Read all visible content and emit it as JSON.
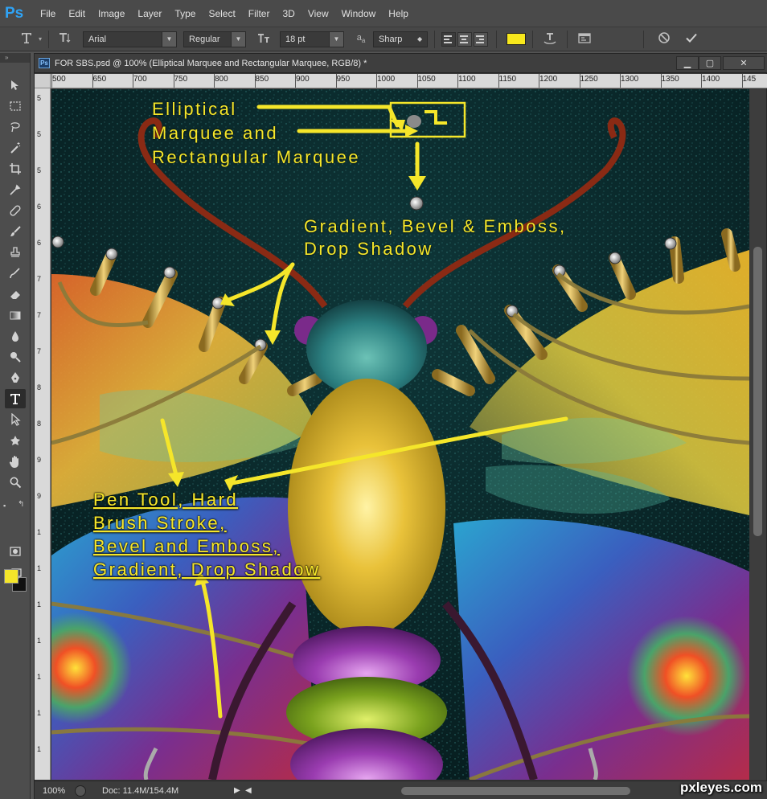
{
  "app_logo": "Ps",
  "menu": [
    "File",
    "Edit",
    "Image",
    "Layer",
    "Type",
    "Select",
    "Filter",
    "3D",
    "View",
    "Window",
    "Help"
  ],
  "options": {
    "font_family": "Arial",
    "font_style": "Regular",
    "font_size": "18 pt",
    "aa_label": "a",
    "aa_sub": "a",
    "antialias": "Sharp",
    "text_color": "#f8e81c"
  },
  "document": {
    "title": "FOR SBS.psd @ 100% (Elliptical Marquee and Rectangular Marquee, RGB/8) *",
    "ps_icon": "Ps",
    "ruler_top": [
      "500",
      "650",
      "700",
      "750",
      "800",
      "850",
      "900",
      "950",
      "1000",
      "1050",
      "1100",
      "1150",
      "1200",
      "1250",
      "1300",
      "1350",
      "1400",
      "145"
    ],
    "ruler_left": [
      "5",
      "5",
      "5",
      "6",
      "6",
      "7",
      "7",
      "7",
      "8",
      "8",
      "9",
      "9",
      "1",
      "1",
      "1",
      "1",
      "1",
      "1",
      "1"
    ]
  },
  "annotations": {
    "marquee": [
      "Elliptical",
      "Marquee and",
      "Rectangular Marquee"
    ],
    "gradient": [
      "Gradient, Bevel & Emboss,",
      "Drop Shadow"
    ],
    "pen": [
      "Pen Tool, Hard",
      "Brush Stroke,",
      "Bevel and Emboss,",
      "Gradient, Drop Shadow"
    ]
  },
  "colors": {
    "annotation": "#f5e62a",
    "fg_swatch": "#f5e62a",
    "bg_swatch": "#111111",
    "accent_blue": "#2fa3f5"
  },
  "status": {
    "zoom": "100%",
    "doc": "Doc: 11.4M/154.4M"
  },
  "watermark": "pxleyes.com",
  "icons": [
    "text-tool-icon",
    "text-orientation-icon",
    "font-size-icon",
    "align-left-icon",
    "align-center-icon",
    "align-right-icon",
    "warp-text-icon",
    "character-panel-icon",
    "cancel-icon",
    "commit-icon"
  ]
}
